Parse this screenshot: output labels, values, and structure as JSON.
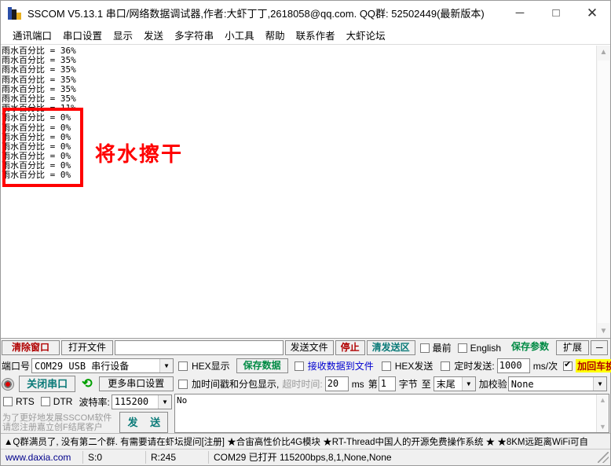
{
  "window": {
    "title": "SSCOM V5.13.1 串口/网络数据调试器,作者:大虾丁丁,2618058@qq.com. QQ群: 52502449(最新版本)",
    "minimize": "─",
    "maximize": "□",
    "close": "✕"
  },
  "menu": {
    "items": [
      {
        "label": "通讯端口"
      },
      {
        "label": "串口设置"
      },
      {
        "label": "显示"
      },
      {
        "label": "发送"
      },
      {
        "label": "多字符串"
      },
      {
        "label": "小工具"
      },
      {
        "label": "帮助"
      },
      {
        "label": "联系作者"
      },
      {
        "label": "大虾论坛"
      }
    ]
  },
  "receive": {
    "lines": [
      "雨水百分比 = 36%",
      "雨水百分比 = 35%",
      "雨水百分比 = 35%",
      "雨水百分比 = 35%",
      "雨水百分比 = 35%",
      "雨水百分比 = 35%",
      "雨水百分比 = 11%",
      "雨水百分比 = 0%",
      "雨水百分比 = 0%",
      "雨水百分比 = 0%",
      "雨水百分比 = 0%",
      "雨水百分比 = 0%",
      "雨水百分比 = 0%",
      "雨水百分比 = 0%"
    ],
    "scroll_up": "▲",
    "scroll_down": "▼"
  },
  "annotation": {
    "text": "将水擦干",
    "color": "#ff0000"
  },
  "toolbar": {
    "clear_window": "清除窗口",
    "open_file": "打开文件",
    "file_path": "",
    "send_file": "发送文件",
    "stop": "停止",
    "clear_send": "清发送区",
    "topmost_label": "最前",
    "topmost_checked": false,
    "english_label": "English",
    "english_checked": false,
    "save_params": "保存参数",
    "extend": "扩展",
    "collapse": "─"
  },
  "port_panel": {
    "port_label": "端口号",
    "port_value": "COM29 USB 串行设备",
    "close_port_button": "关闭串口",
    "more_settings": "更多串口设置",
    "rts_label": "RTS",
    "rts_checked": false,
    "dtr_label": "DTR",
    "dtr_checked": false,
    "baud_label": "波特率:",
    "baud_value": "115200",
    "register_note_line1": "为了更好地发展SSCOM软件",
    "register_note_line2": "请您注册嘉立创F结尾客户",
    "send_button": "发 送"
  },
  "recv_options": {
    "hex_display_label": "HEX显示",
    "hex_display_checked": false,
    "save_data_button": "保存数据",
    "recv_to_file_label": "接收数据到文件",
    "recv_to_file_checked": false,
    "timestamp_label": "加时间戳和分包显示,",
    "timestamp_checked": false,
    "timeout_label": "超时时间:",
    "timeout_value": "20",
    "timeout_unit": "ms",
    "byte_prefix": "第",
    "byte_index": "1",
    "byte_mid": "字节",
    "byte_to": "至",
    "byte_end_value": "末尾",
    "checksum_label": "加校验",
    "checksum_value": "None"
  },
  "send_options": {
    "hex_send_label": "HEX发送",
    "hex_send_checked": false,
    "timed_send_label": "定时发送:",
    "timed_send_checked": false,
    "interval_value": "1000",
    "interval_unit": "ms/次",
    "crlf_label": "加回车换行",
    "crlf_checked": true,
    "help_mark": "?"
  },
  "send_text": {
    "value": "No"
  },
  "ad_bar": {
    "text": "▲Q群满员了, 没有第二个群. 有需要请在虾坛提问[注册] ★合宙高性价比4G模块  ★RT-Thread中国人的开源免费操作系统 ★  ★8KM远距离WiFi可自"
  },
  "status_bar": {
    "website": "www.daxia.com",
    "sent": "S:0",
    "received": "R:245",
    "connection": "COM29 已打开  115200bps,8,1,None,None"
  }
}
